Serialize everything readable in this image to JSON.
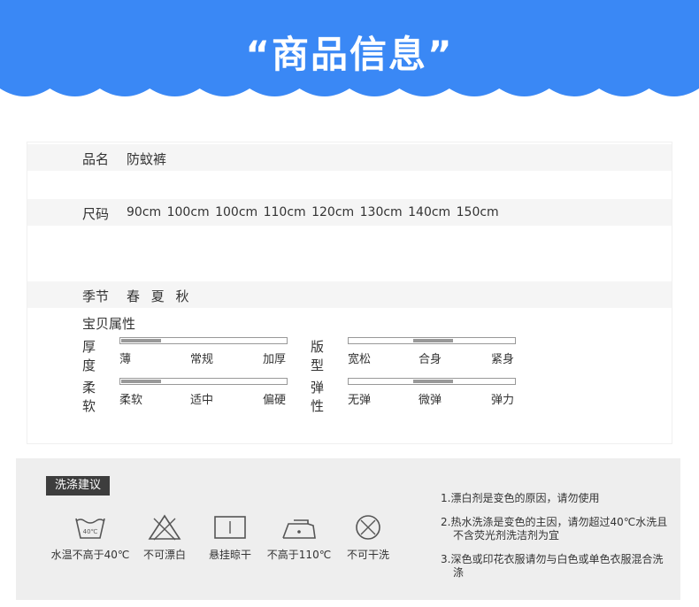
{
  "banner": {
    "title": "“商品信息”",
    "color": "#3a88f5"
  },
  "product": {
    "name_label": "品名",
    "name_value": "防蚊裤",
    "size_label": "尺码",
    "size_value": "90cm 100cm 100cm 110cm 120cm 130cm 140cm 150cm",
    "season_label": "季节",
    "season_value": "春 夏 秋"
  },
  "attributes": {
    "title": "宝贝属性",
    "items": [
      {
        "name": "厚度",
        "ticks": [
          "薄",
          "常规",
          "加厚"
        ],
        "level": 0
      },
      {
        "name": "版型",
        "ticks": [
          "宽松",
          "合身",
          "紧身"
        ],
        "level": 0.5
      },
      {
        "name": "柔软",
        "ticks": [
          "柔软",
          "适中",
          "偏硬"
        ],
        "level": 0
      },
      {
        "name": "弹性",
        "ticks": [
          "无弹",
          "微弹",
          "弹力"
        ],
        "level": 0.5
      }
    ]
  },
  "care": {
    "tag": "洗涤建议",
    "icons": [
      {
        "icon": "wash-40-icon",
        "label": "水温不高于40℃",
        "inner": "40℃"
      },
      {
        "icon": "no-bleach-icon",
        "label": "不可漂白"
      },
      {
        "icon": "hang-dry-icon",
        "label": "悬挂晾干"
      },
      {
        "icon": "iron-icon",
        "label": "不高于110℃"
      },
      {
        "icon": "no-dry-clean-icon",
        "label": "不可干洗"
      }
    ],
    "notes": [
      "1.漂白剂是变色的原因，请勿使用",
      "2.热水洗涤是变色的主因，请勿超过40℃水洗且不含荧光剂洗洁剂为宜",
      "3.深色或印花衣服请勿与白色或单色衣服混合洗涤"
    ]
  }
}
